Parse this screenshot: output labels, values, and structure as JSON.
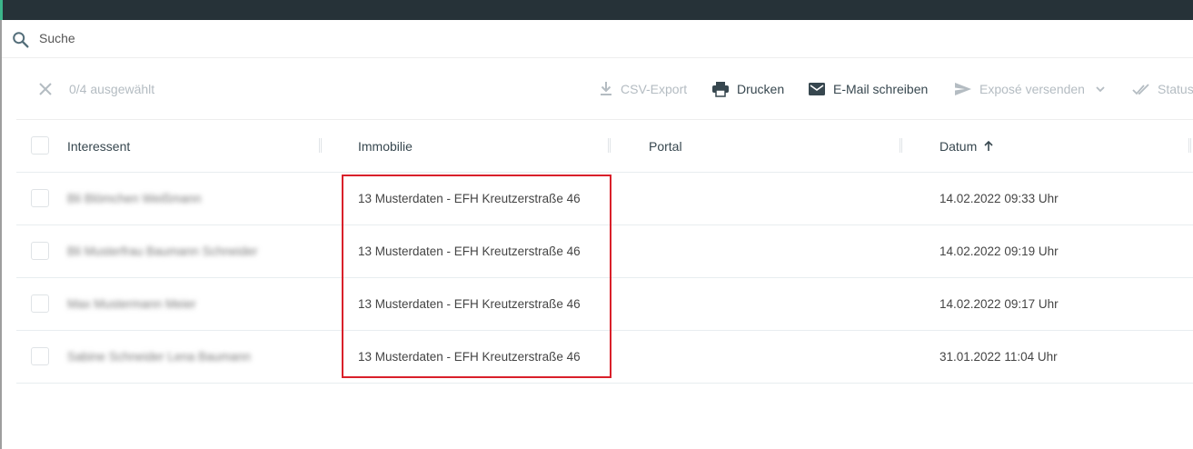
{
  "search": {
    "label": "Suche",
    "icon": "search-icon"
  },
  "toolbar": {
    "selection": "0/4 ausgewählt",
    "csv_export": "CSV-Export",
    "print": "Drucken",
    "email": "E-Mail schreiben",
    "expose": "Exposé versenden",
    "status": "Status"
  },
  "table": {
    "columns": {
      "interessent": "Interessent",
      "immobilie": "Immobilie",
      "portal": "Portal",
      "datum": "Datum"
    },
    "rows": [
      {
        "interessent": "Bli Blömchen Weißmann",
        "immobilie": "13 Musterdaten - EFH Kreutzerstraße 46",
        "portal": "",
        "datum": "14.02.2022 09:33 Uhr"
      },
      {
        "interessent": "Bli Musterfrau Baumann Schneider",
        "immobilie": "13 Musterdaten - EFH Kreutzerstraße 46",
        "portal": "",
        "datum": "14.02.2022 09:19 Uhr"
      },
      {
        "interessent": "Max Mustermann Meier",
        "immobilie": "13 Musterdaten - EFH Kreutzerstraße 46",
        "portal": "",
        "datum": "14.02.2022 09:17 Uhr"
      },
      {
        "interessent": "Sabine Schneider Lena Baumann",
        "immobilie": "13 Musterdaten - EFH Kreutzerstraße 46",
        "portal": "",
        "datum": "31.01.2022 11:04 Uhr"
      }
    ]
  },
  "colors": {
    "topbar": "#263238",
    "accent": "#3bb58a",
    "highlight": "#d9202a",
    "disabled": "#b4bcc2"
  }
}
